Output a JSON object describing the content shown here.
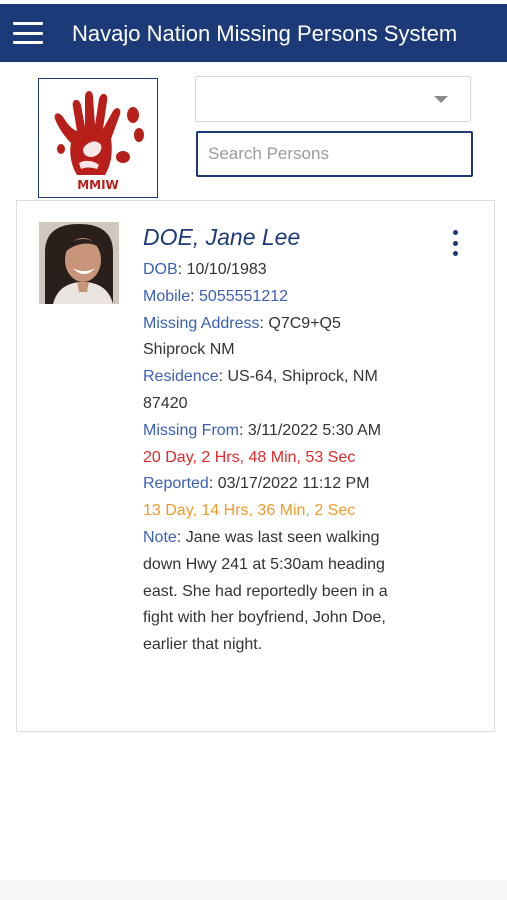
{
  "header": {
    "title": "Navajo Nation Missing Persons System",
    "menu_icon": "hamburger-menu-icon",
    "background_color": "#1c3a78"
  },
  "logo": {
    "text": "MMIW",
    "icon": "red-handprint-icon"
  },
  "filters": {
    "select_value": "",
    "search_placeholder": "Search Persons",
    "search_value": ""
  },
  "person": {
    "name": "DOE, Jane Lee",
    "dob_label": "DOB",
    "dob_value": "10/10/1983",
    "mobile_label": "Mobile",
    "mobile_value": "5055551212",
    "missing_address_label": "Missing Address",
    "missing_address_value": "Q7C9+Q5 Shiprock NM",
    "residence_label": "Residence",
    "residence_value": "US-64, Shiprock, NM 87420",
    "missing_from_label": "Missing From",
    "missing_from_value": "3/11/2022 5:30 AM",
    "missing_elapsed": "20 Day, 2 Hrs, 48 Min, 53 Sec",
    "reported_label": "Reported",
    "reported_value": "03/17/2022 11:12 PM",
    "reported_elapsed": "13 Day, 14 Hrs, 36 Min, 2 Sec",
    "note_label": "Note",
    "note_value": "Jane was last seen walking down Hwy 241 at 5:30am heading east. She had reportedly been in a fight with her boyfriend, John Doe, earlier that night."
  },
  "colors": {
    "label_blue": "#3a5fb5",
    "missing_elapsed_red": "#e02a2a",
    "reported_elapsed_orange": "#ef9b2b"
  }
}
